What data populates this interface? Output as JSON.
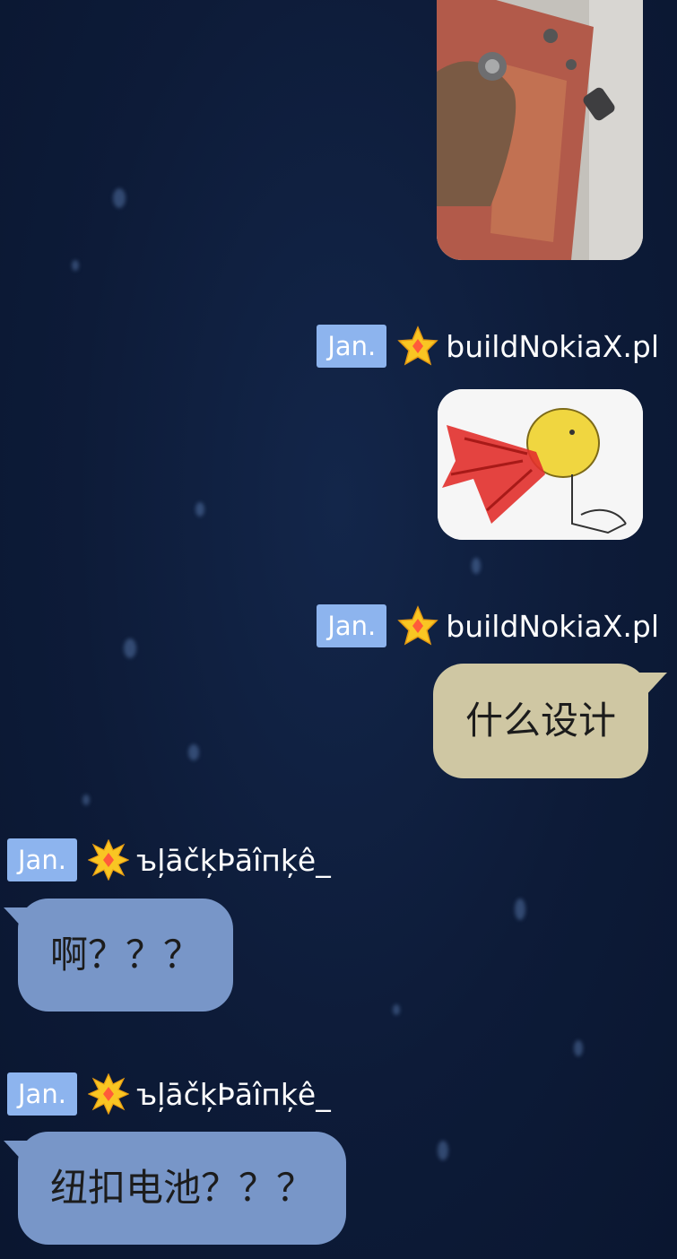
{
  "messages": [
    {
      "type": "image",
      "side": "right",
      "description": "photo-held-battery"
    },
    {
      "type": "image",
      "side": "right",
      "tag": "Jan.",
      "name": "buildNokiaX.pl",
      "badge": "star-badge-icon",
      "description": "meme-spitting-face"
    },
    {
      "type": "text",
      "side": "right",
      "tag": "Jan.",
      "name": "buildNokiaX.pl",
      "badge": "star-badge-icon",
      "text": "什么设计"
    },
    {
      "type": "text",
      "side": "left",
      "tag": "Jan.",
      "name": "ъļāčķÞāîпķê_",
      "badge": "sparkle-badge-icon",
      "text": "啊？？？"
    },
    {
      "type": "text",
      "side": "left",
      "tag": "Jan.",
      "name": "ъļāčķÞāîпķê_",
      "badge": "sparkle-badge-icon",
      "text": "纽扣电池？？？"
    }
  ],
  "colors": {
    "background": "#0d1b38",
    "tag": "#8db4ee",
    "bubble_right": "#cfc7a3",
    "bubble_left": "#7896c8",
    "name_text": "#ffffff"
  }
}
